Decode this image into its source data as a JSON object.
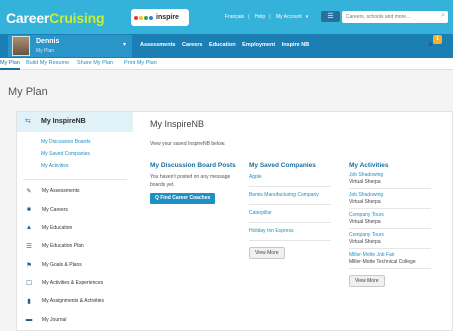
{
  "brand": {
    "part1": "Career",
    "part2": "Cruising"
  },
  "partner_logo": {
    "text": "inspire"
  },
  "top_links": {
    "language": "Français",
    "help": "Help",
    "account": "My Account"
  },
  "search": {
    "placeholder": "Careers, schools and more..."
  },
  "user": {
    "name": "Dennis",
    "plan": "My Plan"
  },
  "main_nav": [
    "Assessments",
    "Careers",
    "Education",
    "Employment",
    "Inspire NB"
  ],
  "notification": {
    "count": "1"
  },
  "sub_tabs": [
    "My Plan",
    "Build My Resume",
    "Share My Plan",
    "Print My Plan"
  ],
  "page_title": "My Plan",
  "sidebar": {
    "header": "My InspireNB",
    "links": [
      "My Discussion Boards",
      "My Saved Companies",
      "My Activities"
    ],
    "items": [
      {
        "icon": "pencil-icon",
        "label": "My Assessments"
      },
      {
        "icon": "briefcase-icon",
        "label": "My Careers"
      },
      {
        "icon": "graduation-cap-icon",
        "label": "My Education"
      },
      {
        "icon": "list-icon",
        "label": "My Education Plan"
      },
      {
        "icon": "flag-icon",
        "label": "My Goals & Plans"
      },
      {
        "icon": "edit-icon",
        "label": "My Activities & Experiences"
      },
      {
        "icon": "clipboard-icon",
        "label": "My Assignments & Activities"
      },
      {
        "icon": "book-icon",
        "label": "My Journal"
      }
    ]
  },
  "content": {
    "title": "My InspireNB",
    "description": "View your saved InspireNB below.",
    "discussion": {
      "title": "My Discussion Board Posts",
      "empty_text": "You haven't posted on any message boards yet.",
      "button": "Q Find Career Coaches"
    },
    "companies": {
      "title": "My Saved Companies",
      "items": [
        "Apple",
        "Bemis Manufacturing Company",
        "Caterpillar",
        "Holiday Inn Express"
      ],
      "button": "View More"
    },
    "activities": {
      "title": "My Activities",
      "items": [
        {
          "title": "Job Shadowing",
          "sub": "Virtual Sherpa"
        },
        {
          "title": "Job Shadowing",
          "sub": "Virtual Sherpa"
        },
        {
          "title": "Company Tours",
          "sub": "Virtual Sherpa"
        },
        {
          "title": "Company Tours",
          "sub": "Virtual Sherpa"
        },
        {
          "title": "Miller-Motte Job Fair",
          "sub": "Miller-Motte Technical College"
        }
      ],
      "button": "View More"
    }
  },
  "colors": {
    "topbar": "#34b2d9",
    "navbar": "#1b7fb4",
    "brand_accent": "#c6ee3a",
    "link": "#1f8fc6"
  }
}
